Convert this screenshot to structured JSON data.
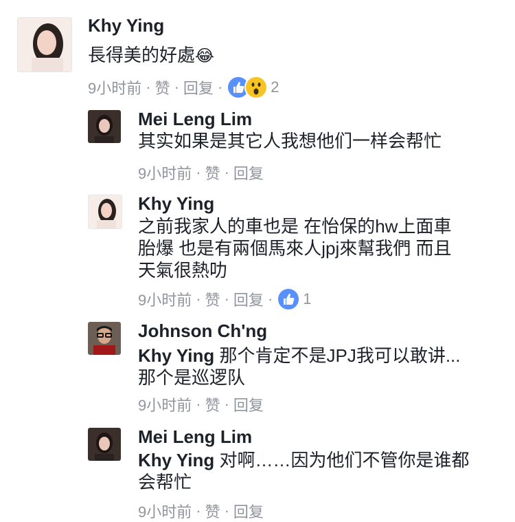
{
  "comments": [
    {
      "name": "Khy Ying",
      "text": "長得美的好處",
      "emoji": "😂",
      "time": "9小时前",
      "like": "赞",
      "reply": "回复",
      "reaction_count": "2"
    },
    {
      "name": "Mei Leng Lim",
      "text": "其实如果是其它人我想他们一样会帮忙",
      "time": "9小时前",
      "like": "赞",
      "reply": "回复"
    },
    {
      "name": "Khy Ying",
      "lines": [
        "之前我家人的車也是 在怡保的hw上面車",
        "胎爆 也是有兩個馬來人jpj來幫我們 而且",
        "天氣很熱叻"
      ],
      "time": "9小时前",
      "like": "赞",
      "reply": "回复",
      "reaction_count": "1"
    },
    {
      "name": "Johnson Ch'ng",
      "mention": "Khy Ying",
      "line1_rest": " 那个肯定不是JPJ我可以敢讲...",
      "line2": "那个是巡逻队",
      "time": "9小时前",
      "like": "赞",
      "reply": "回复"
    },
    {
      "name": "Mei Leng Lim",
      "mention": "Khy Ying",
      "line1_rest": " 对啊……因为他们不管你是谁都",
      "line2": "会帮忙",
      "time": "9小时前",
      "like": "赞",
      "reply": "回复"
    }
  ],
  "separator": "·",
  "colors": {
    "like_blue": "#5890ff",
    "wow_yellow": "#f7c325",
    "meta_gray": "#90949c"
  }
}
